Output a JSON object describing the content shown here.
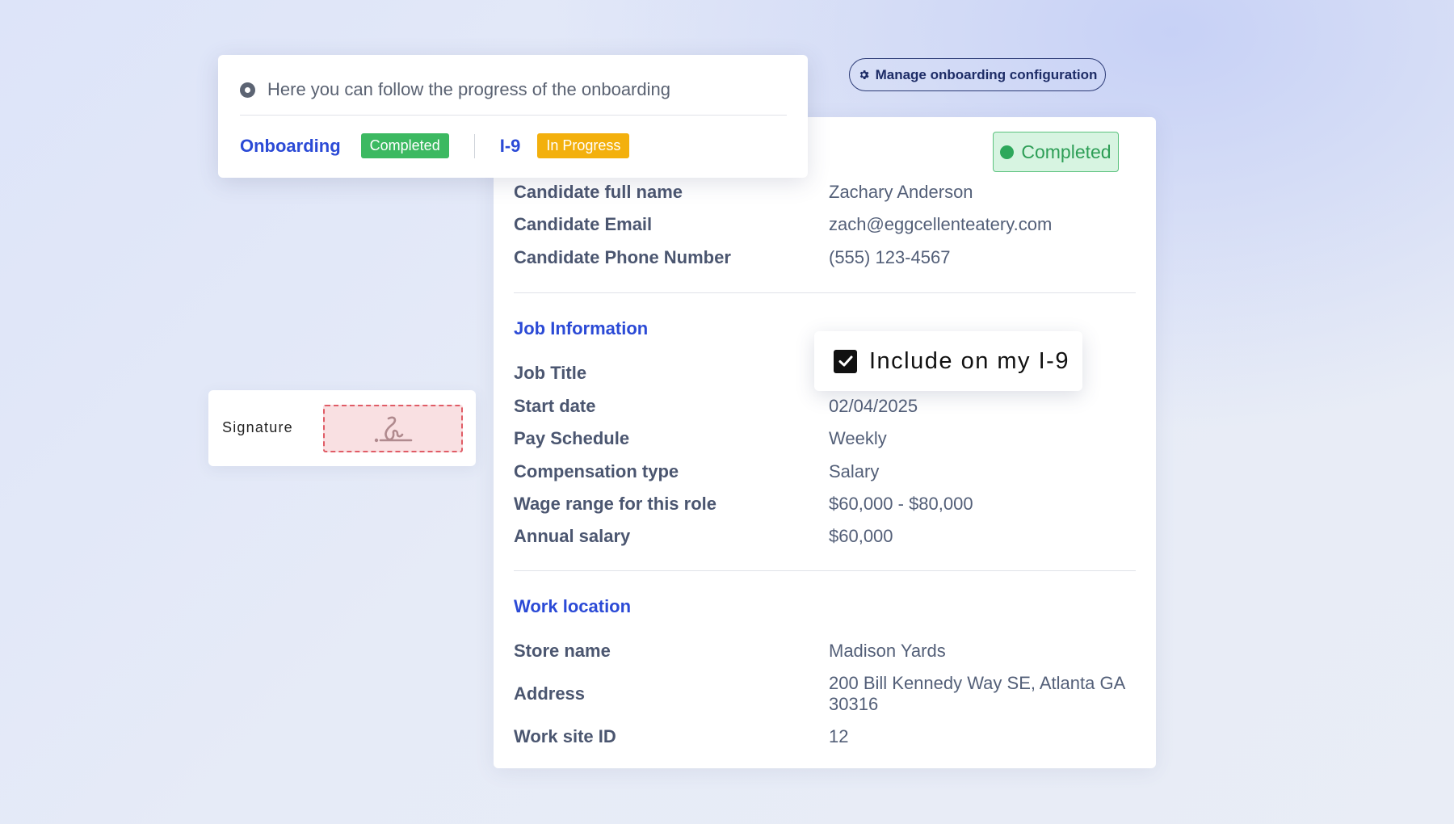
{
  "manage_button": {
    "label": "Manage onboarding configuration",
    "icon": "gear-icon"
  },
  "progress": {
    "hint": "Here you can follow the progress of the onboarding",
    "onboarding": {
      "label": "Onboarding",
      "status": "Completed"
    },
    "i9": {
      "label": "I-9",
      "status": "In Progress"
    }
  },
  "status_badge": "Completed",
  "candidate": {
    "full_name": {
      "label": "Candidate full name",
      "value": "Zachary Anderson"
    },
    "email": {
      "label": "Candidate Email",
      "value": "zach@eggcellenteatery.com"
    },
    "phone": {
      "label": "Candidate Phone Number",
      "value": "(555) 123-4567"
    }
  },
  "job": {
    "title": "Job Information",
    "job_title": {
      "label": "Job Title",
      "value": ""
    },
    "start_date": {
      "label": "Start date",
      "value": "02/04/2025"
    },
    "pay_schedule": {
      "label": "Pay Schedule",
      "value": "Weekly"
    },
    "compensation_type": {
      "label": "Compensation type",
      "value": "Salary"
    },
    "wage_range": {
      "label": "Wage range for this role",
      "value": "$60,000 - $80,000"
    },
    "annual_salary": {
      "label": "Annual salary",
      "value": "$60,000"
    }
  },
  "include_i9": {
    "label": "Include on my I-9",
    "checked": true
  },
  "location": {
    "title": "Work location",
    "store_name": {
      "label": "Store name",
      "value": "Madison Yards"
    },
    "address": {
      "label": "Address",
      "value_line1": "200 Bill Kennedy Way SE, Atlanta GA",
      "value_line2": "30316"
    },
    "work_site_id": {
      "label": "Work site ID",
      "value": "12"
    }
  },
  "signature": {
    "label": "Signature",
    "icon": "signature-icon"
  },
  "colors": {
    "accent_blue": "#2b4ad6",
    "completed_green": "#3cb961",
    "in_progress_amber": "#f3b00d",
    "signature_red": "#e05c66"
  }
}
